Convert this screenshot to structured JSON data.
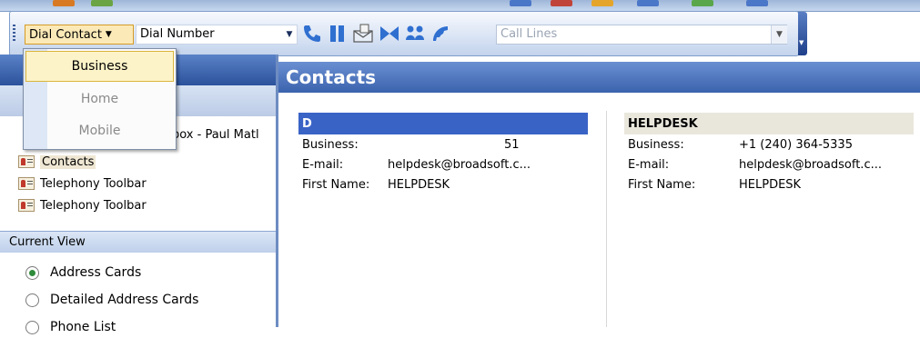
{
  "toolbar": {
    "dial_contact_label": "Dial Contact",
    "dial_number_value": "Dial Number",
    "call_lines_placeholder": "Call Lines",
    "icons": [
      "phone-dial-icon",
      "pause-icon",
      "message-icon",
      "transfer-icon",
      "conference-icon",
      "hangup-icon"
    ]
  },
  "dial_menu": {
    "items": [
      {
        "label": "Business",
        "state": "active"
      },
      {
        "label": "Home",
        "state": "disabled"
      },
      {
        "label": "Mobile",
        "state": "disabled"
      }
    ]
  },
  "nav": {
    "partial_item": "box - Paul Matl",
    "folders": [
      {
        "label": "Contacts",
        "selected": true
      },
      {
        "label": "Telephony Toolbar",
        "selected": false
      },
      {
        "label": "Telephony Toolbar",
        "selected": false
      }
    ],
    "current_view_header": "Current View",
    "views": [
      {
        "label": "Address Cards",
        "checked": true
      },
      {
        "label": "Detailed Address Cards",
        "checked": false
      },
      {
        "label": "Phone List",
        "checked": false
      }
    ]
  },
  "main": {
    "title": "Contacts",
    "cards": [
      {
        "title": "D",
        "selected": true,
        "rows": [
          {
            "key": "Business:",
            "value": "51"
          },
          {
            "key": "E-mail:",
            "value": "helpdesk@broadsoft.c..."
          },
          {
            "key": "First Name:",
            "value": "HELPDESK"
          }
        ]
      },
      {
        "title": "HELPDESK",
        "selected": false,
        "rows": [
          {
            "key": "Business:",
            "value": "+1 (240) 364-5335"
          },
          {
            "key": "E-mail:",
            "value": "helpdesk@broadsoft.c..."
          },
          {
            "key": "First Name:",
            "value": "HELPDESK"
          }
        ]
      }
    ]
  },
  "colors": {
    "header_blue": "#3b63ad",
    "selection_blue": "#3a63c6",
    "menu_highlight": "#fdf3c8"
  }
}
